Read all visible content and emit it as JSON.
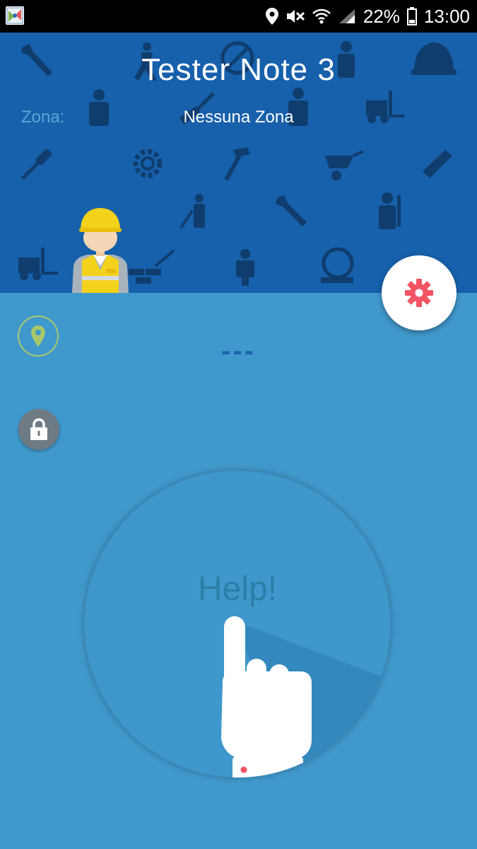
{
  "status_bar": {
    "battery": "22%",
    "time": "13:00",
    "icons": [
      "location-icon",
      "vibrate-mute-icon",
      "wifi-icon",
      "signal-icon",
      "battery-icon"
    ]
  },
  "header": {
    "title": "Tester Note 3",
    "zone_label": "Zona:",
    "zone_value": "Nessuna Zona"
  },
  "main": {
    "readout": "---",
    "help_label": "Help!"
  },
  "colors": {
    "header_bg": "#1760ab",
    "main_bg": "#4099cd",
    "accent_red": "#f25466",
    "location_green": "#a9c86a"
  }
}
